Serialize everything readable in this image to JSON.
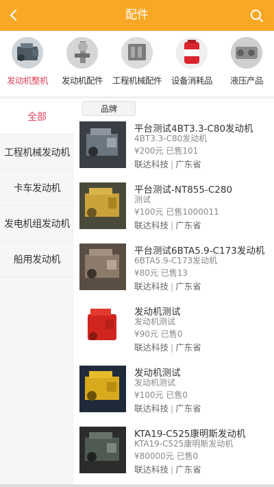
{
  "header": {
    "title": "配件",
    "back_icon": "chevron-left-icon",
    "search_icon": "search-icon",
    "bg_color": "#f9a825"
  },
  "categories": [
    {
      "label": "发动机整机",
      "active": true
    },
    {
      "label": "发动机配件",
      "active": false
    },
    {
      "label": "工程机械配件",
      "active": false
    },
    {
      "label": "设备消耗品",
      "active": false
    },
    {
      "label": "液压产品",
      "active": false
    }
  ],
  "sidebar": {
    "items": [
      {
        "label": "全部",
        "active": true
      },
      {
        "label": "工程机械发动机",
        "active": false
      },
      {
        "label": "卡车发动机",
        "active": false
      },
      {
        "label": "发电机组发动机",
        "active": false
      },
      {
        "label": "船用发动机",
        "active": false
      }
    ]
  },
  "filter": {
    "brand_label": "品牌"
  },
  "products": [
    {
      "title": "平台测试4BT3.3-C80发动机",
      "subtitle": "4BT3.3-C80发动机",
      "price": "¥200元 已售101",
      "shop": "联达科技",
      "region": "广东省"
    },
    {
      "title": "平台测试-NT855-C280",
      "subtitle": "测试",
      "price": "¥100元 已售1000011",
      "shop": "联达科技",
      "region": "广东省"
    },
    {
      "title": "平台测试6BTA5.9-C173发动机",
      "subtitle": "6BTA5.9-C173发动机",
      "price": "¥80元 已售13",
      "shop": "联达科技",
      "region": "广东省"
    },
    {
      "title": "发动机测试",
      "subtitle": "发动机测试",
      "price": "¥90元 已售0",
      "shop": "联达科技",
      "region": "广东省"
    },
    {
      "title": "发动机测试",
      "subtitle": "发动机测试",
      "price": "¥100元 已售0",
      "shop": "联达科技",
      "region": "广东省"
    },
    {
      "title": "KTA19-C525康明斯发动机",
      "subtitle": "KTA19-C525康明斯发动机",
      "price": "¥80000元 已售0",
      "shop": "联达科技",
      "region": "广东省"
    }
  ],
  "colors": {
    "accent": "#e5435a",
    "header": "#f9a825"
  }
}
